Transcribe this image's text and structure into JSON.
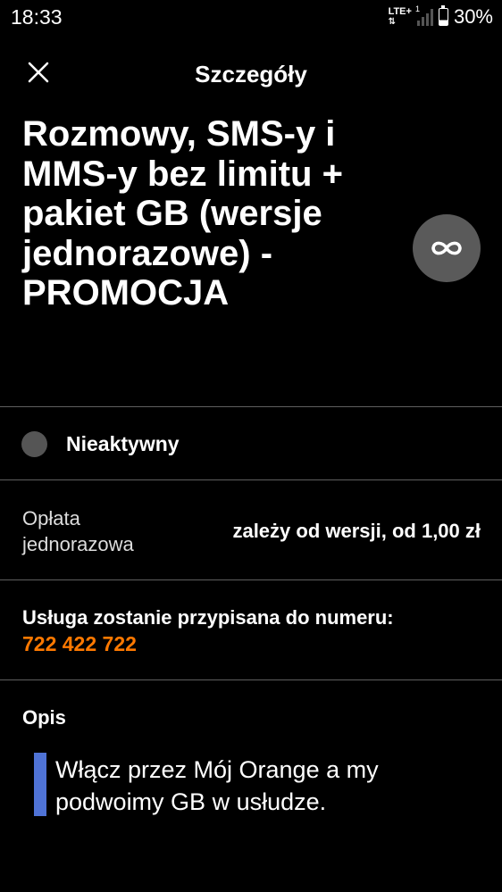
{
  "status_bar": {
    "time": "18:33",
    "network": "LTE+",
    "battery_percent": "30%"
  },
  "header": {
    "title": "Szczegóły"
  },
  "offer": {
    "title": "Rozmowy, SMS-y i MMS-y bez limitu + pakiet GB (wersje jednorazowe) - PROMOCJA",
    "badge_icon": "infinity-icon",
    "status": "Nieaktywny"
  },
  "fee": {
    "label": "Opłata jednorazowa",
    "value": "zależy od wersji, od 1,00 zł"
  },
  "assignment": {
    "label": "Usługa zostanie przypisana do numeru:",
    "number": "722 422 722"
  },
  "description": {
    "heading": "Opis",
    "text": "Włącz przez Mój Orange a my podwoimy GB w usłudze."
  },
  "colors": {
    "background": "#000000",
    "accent_orange": "#ff7900",
    "quote_bar_blue": "#4f73d6",
    "badge_gray": "#5a5a5a",
    "inactive_dot": "#555555"
  }
}
